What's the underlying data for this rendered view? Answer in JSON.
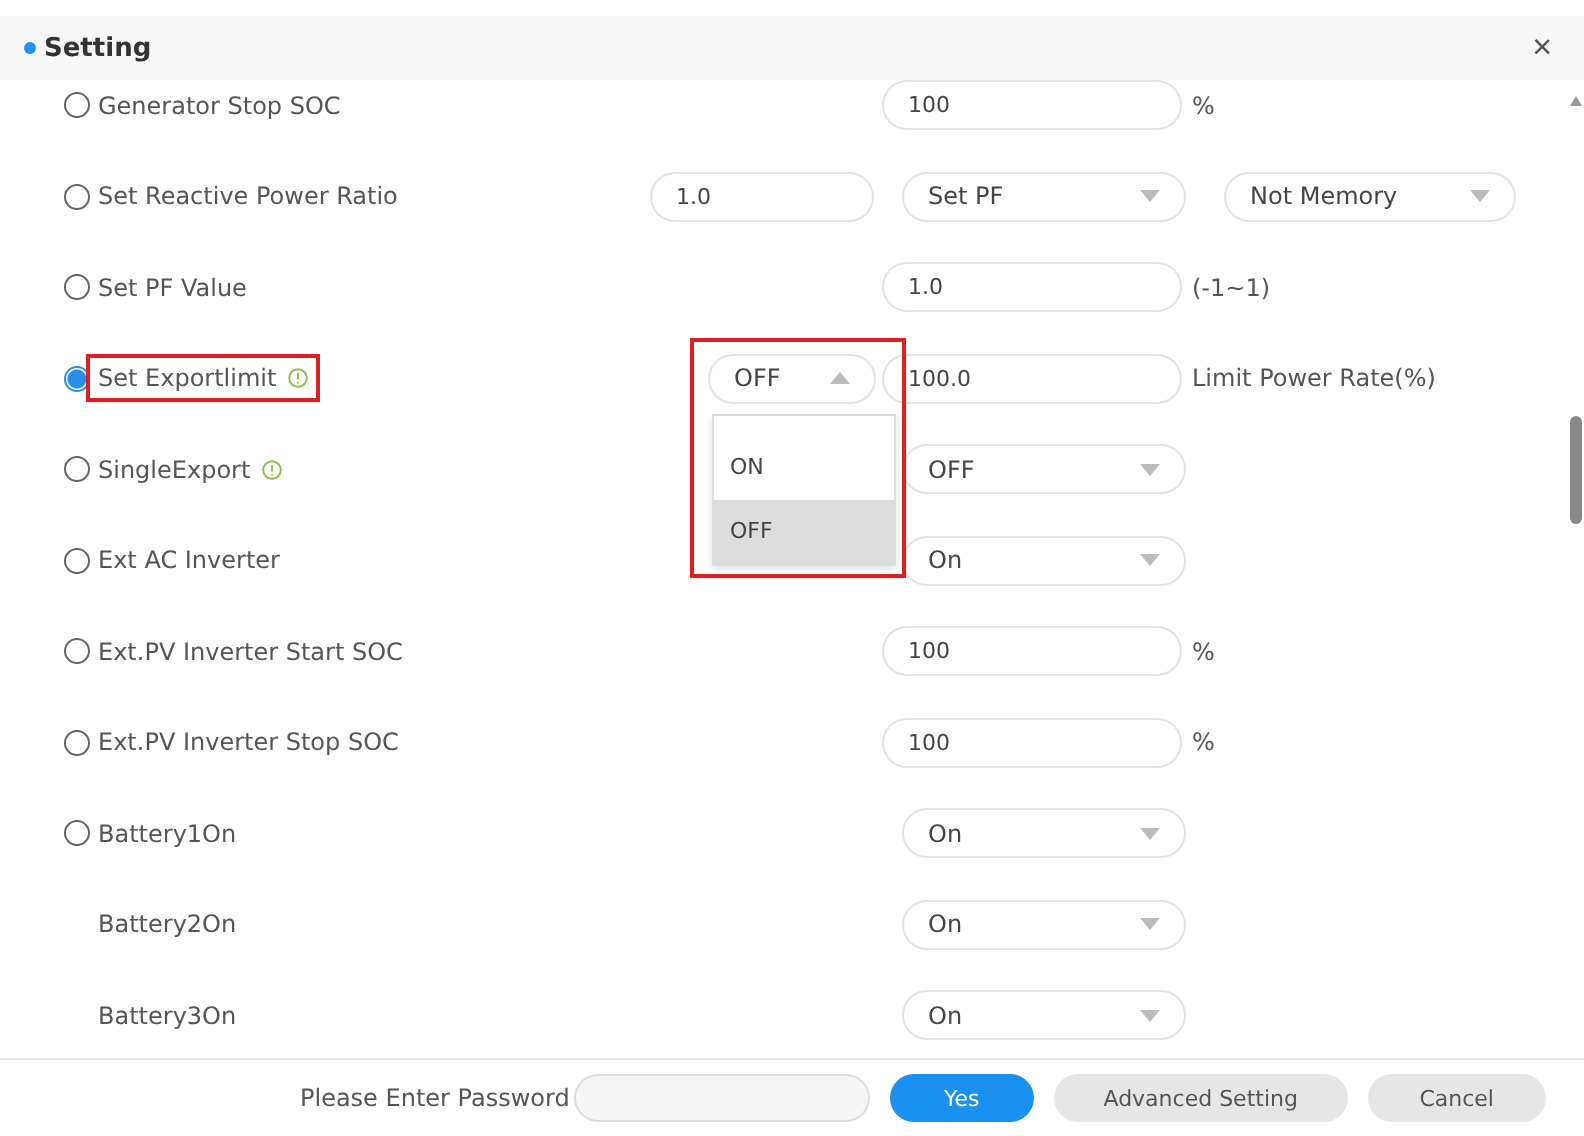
{
  "dialog": {
    "title": "Setting",
    "close": "×"
  },
  "rows": [
    {
      "label": "Generator Stop SOC",
      "radio": true,
      "selected": false,
      "info": false,
      "highlighted": false,
      "controls": [
        {
          "kind": "input",
          "value": "100"
        }
      ],
      "unit": "%"
    },
    {
      "label": "Set Reactive Power Ratio",
      "radio": true,
      "selected": false,
      "info": false,
      "highlighted": false,
      "controls": [
        {
          "kind": "input",
          "value": "1.0"
        },
        {
          "kind": "select",
          "value": "Set PF"
        },
        {
          "kind": "select",
          "value": "Not Memory"
        }
      ]
    },
    {
      "label": "Set PF Value",
      "radio": true,
      "selected": false,
      "info": false,
      "highlighted": false,
      "controls": [
        {
          "kind": "input",
          "value": "1.0"
        }
      ],
      "unit": "(-1~1)"
    },
    {
      "label": "Set Exportlimit",
      "radio": true,
      "selected": true,
      "info": true,
      "highlighted": true,
      "controls": [
        {
          "kind": "select",
          "value": "OFF",
          "expanded": true,
          "highlighted": true,
          "options": [
            {
              "label": "ON",
              "selected": false
            },
            {
              "label": "OFF",
              "selected": true
            }
          ]
        },
        {
          "kind": "input",
          "value": "100.0"
        }
      ],
      "unit": "Limit Power Rate(%)"
    },
    {
      "label": "SingleExport",
      "radio": true,
      "selected": false,
      "info": true,
      "highlighted": false,
      "controls": [
        {
          "kind": "select",
          "value": "OFF"
        }
      ]
    },
    {
      "label": "Ext AC Inverter",
      "radio": true,
      "selected": false,
      "info": false,
      "highlighted": false,
      "controls": [
        {
          "kind": "select",
          "value": "On"
        }
      ]
    },
    {
      "label": "Ext.PV Inverter Start SOC",
      "radio": true,
      "selected": false,
      "info": false,
      "highlighted": false,
      "controls": [
        {
          "kind": "input",
          "value": "100"
        }
      ],
      "unit": "%"
    },
    {
      "label": "Ext.PV Inverter Stop SOC",
      "radio": true,
      "selected": false,
      "info": false,
      "highlighted": false,
      "controls": [
        {
          "kind": "input",
          "value": "100"
        }
      ],
      "unit": "%"
    },
    {
      "label": "Battery1On",
      "radio": true,
      "selected": false,
      "info": false,
      "highlighted": false,
      "controls": [
        {
          "kind": "select",
          "value": "On"
        }
      ]
    },
    {
      "label": "Battery2On",
      "radio": false,
      "info": false,
      "highlighted": false,
      "controls": [
        {
          "kind": "select",
          "value": "On"
        }
      ]
    },
    {
      "label": "Battery3On",
      "radio": false,
      "info": false,
      "highlighted": false,
      "controls": [
        {
          "kind": "select",
          "value": "On"
        }
      ]
    }
  ],
  "footer": {
    "password_label": "Please Enter Password",
    "buttons": [
      {
        "label": "Yes",
        "kind": "primary"
      },
      {
        "label": "Advanced Setting",
        "kind": "secondary"
      },
      {
        "label": "Cancel",
        "kind": "secondary"
      }
    ]
  }
}
